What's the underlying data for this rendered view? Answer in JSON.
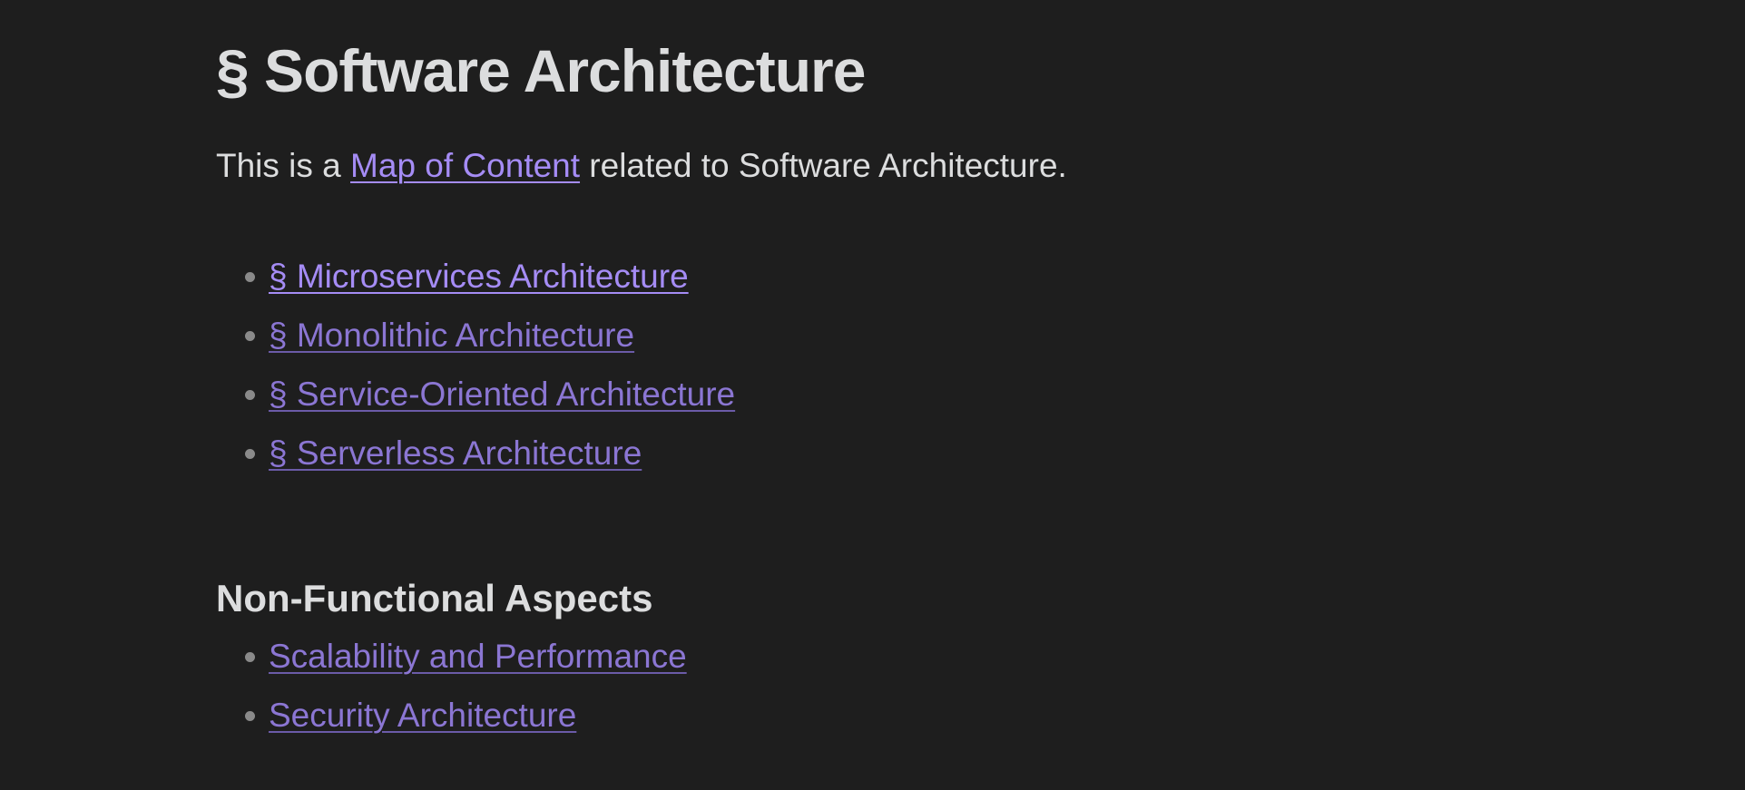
{
  "note": {
    "title": "§ Software Architecture",
    "intro": {
      "before": "This is a ",
      "link": "Map of Content",
      "after": " related to Software Architecture."
    },
    "links": [
      {
        "label": "§ Microservices Architecture"
      },
      {
        "label": "§ Monolithic Architecture"
      },
      {
        "label": "§ Service-Oriented Architecture"
      },
      {
        "label": "§ Serverless Architecture"
      }
    ],
    "section": {
      "heading": "Non-Functional Aspects",
      "links": [
        {
          "label": "Scalability and Performance"
        },
        {
          "label": "Security Architecture"
        }
      ]
    }
  },
  "colors": {
    "background": "#1e1e1e",
    "text": "#dcddde",
    "link": "#a58cf5",
    "link_faded": "#8b76d3",
    "bullet": "#8a8a8a"
  }
}
